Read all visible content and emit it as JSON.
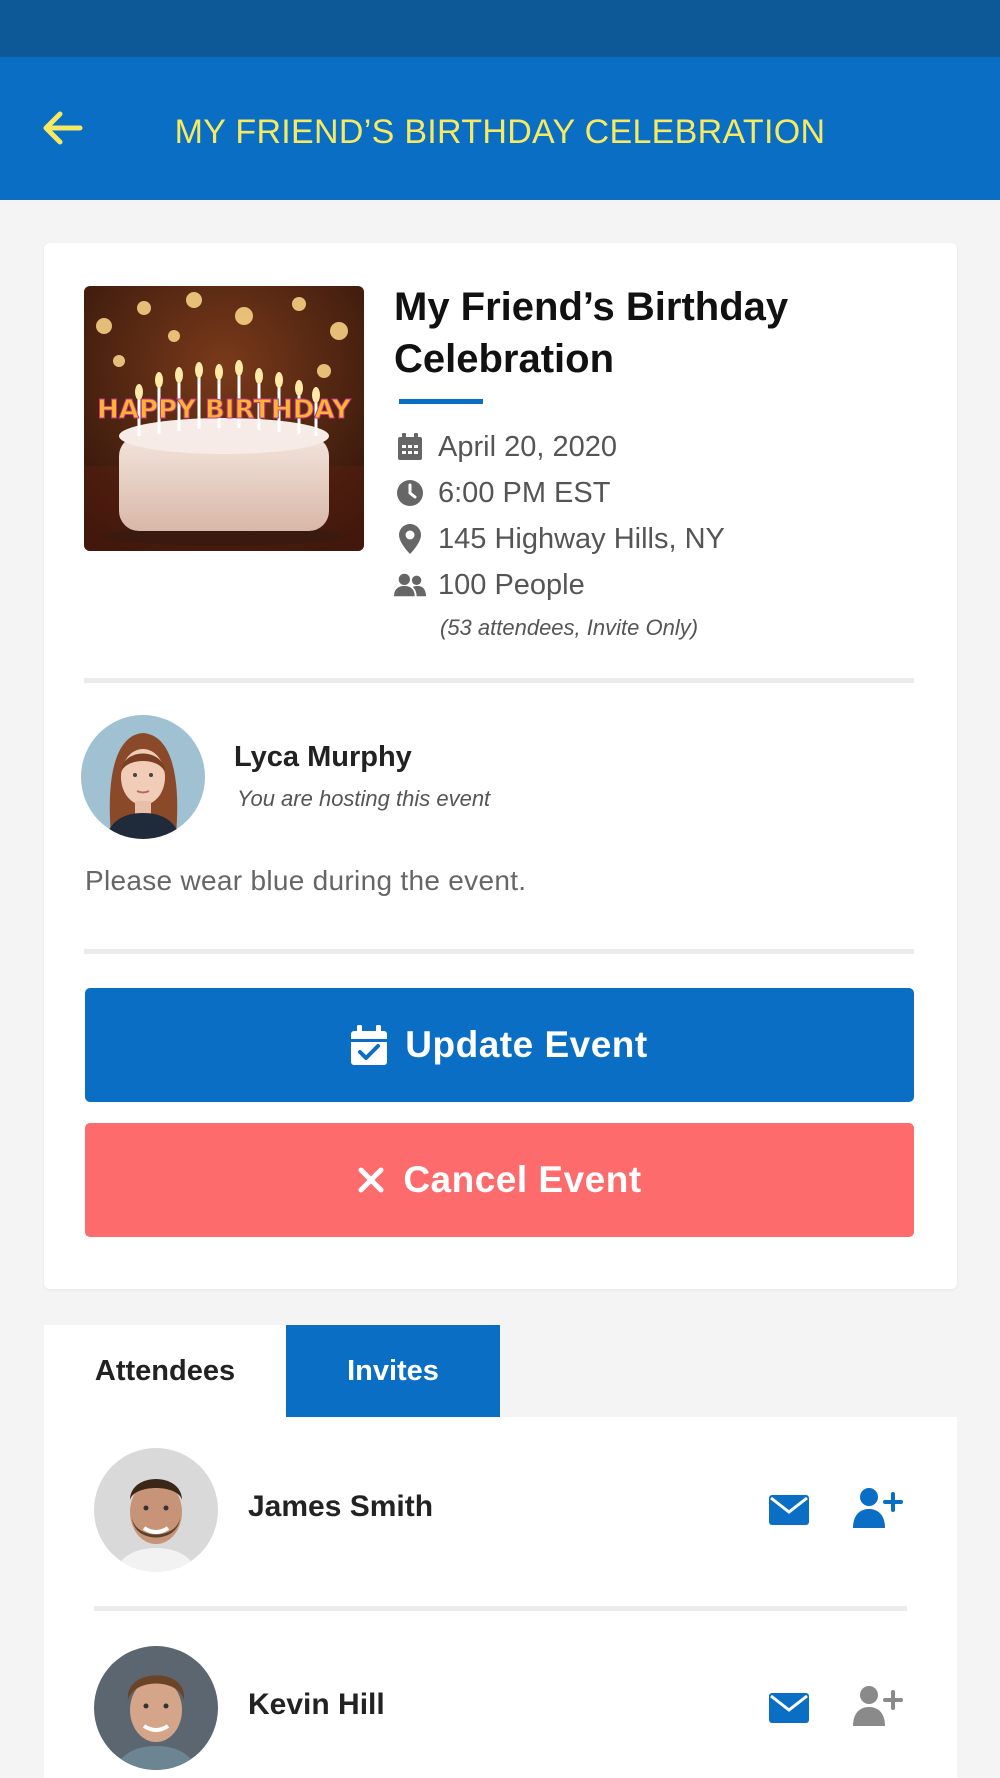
{
  "header": {
    "title": "MY FRIEND’S BIRTHDAY CELEBRATION",
    "back_icon": "arrow-left-icon",
    "title_color": "#f6ea62",
    "background": "#0a6ec4"
  },
  "event": {
    "title": "My Friend’s Birthday Celebration",
    "image_caption": "HAPPY BIRTHDAY",
    "date": "April 20, 2020",
    "time": "6:00 PM EST",
    "location": "145 Highway Hills, NY",
    "capacity": "100 People",
    "capacity_note": "(53 attendees, Invite Only)",
    "icons": [
      "calendar-icon",
      "clock-icon",
      "map-pin-icon",
      "users-icon"
    ]
  },
  "host": {
    "name": "Lyca Murphy",
    "subtitle": "You are hosting this event"
  },
  "note": "Please wear blue during the event.",
  "actions": {
    "update_label": "Update Event",
    "cancel_label": "Cancel Event",
    "update_color": "#0a6ec4",
    "cancel_color": "#fd6b6d"
  },
  "tabs": [
    {
      "label": "Attendees",
      "active": false
    },
    {
      "label": "Invites",
      "active": true
    }
  ],
  "invites": [
    {
      "name": "James Smith",
      "add_icon_state": "active"
    },
    {
      "name": "Kevin Hill",
      "add_icon_state": "inactive"
    }
  ]
}
